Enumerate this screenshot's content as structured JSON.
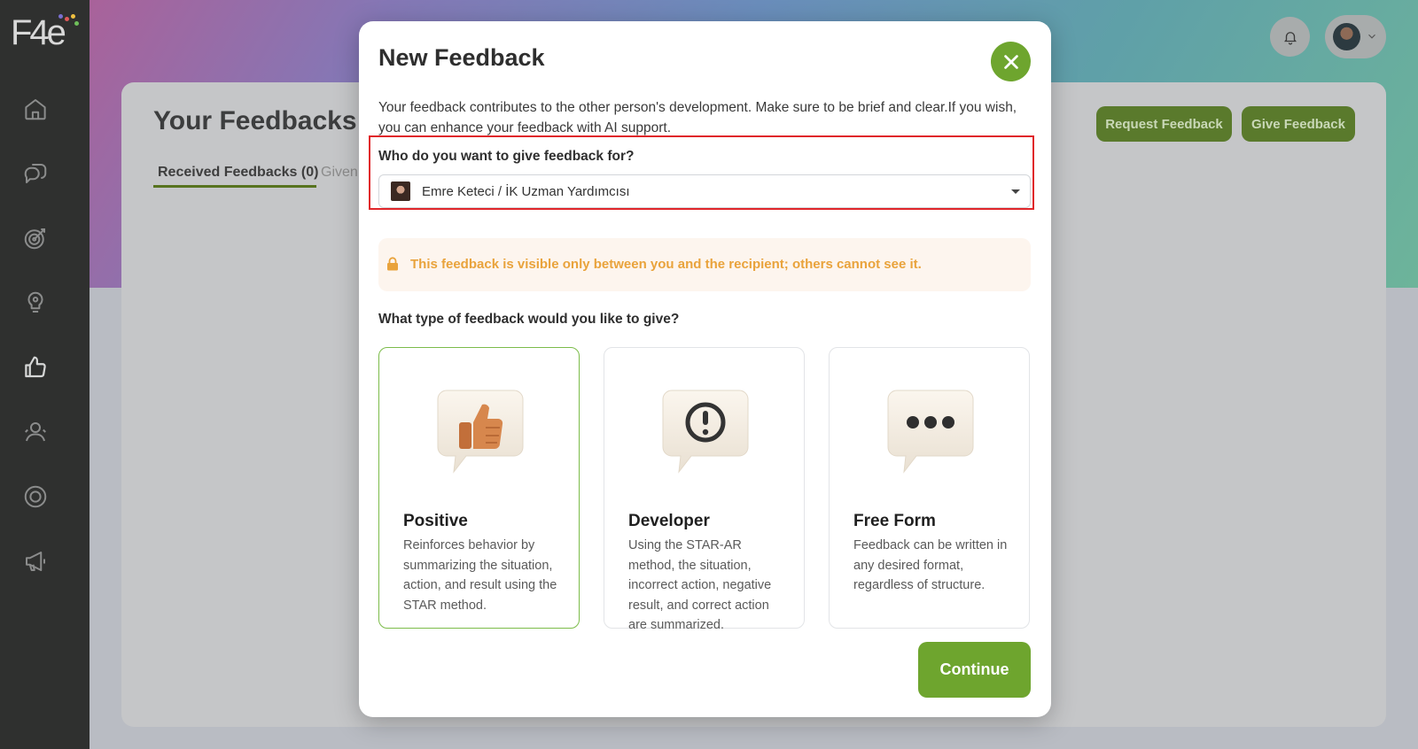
{
  "app": {
    "logo_text": "F4e"
  },
  "sidebar": {
    "items": [
      {
        "icon": "home-icon"
      },
      {
        "icon": "chat-icon"
      },
      {
        "icon": "target-icon"
      },
      {
        "icon": "lightbulb-icon"
      },
      {
        "icon": "thumbs-up-icon",
        "active": true
      },
      {
        "icon": "users-icon"
      },
      {
        "icon": "settings-icon"
      },
      {
        "icon": "megaphone-icon"
      }
    ]
  },
  "header": {
    "bell_icon": "bell-icon"
  },
  "page": {
    "title": "Your Feedbacks",
    "tabs": [
      {
        "label": "Received Feedbacks (0)",
        "active": true
      },
      {
        "label": "Given"
      }
    ],
    "request_button": "Request Feedback",
    "give_button": "Give Feedback"
  },
  "modal": {
    "title": "New Feedback",
    "intro": "Your feedback contributes to the other person's development. Make sure to be brief and clear.If you wish, you can enhance your feedback with AI support.",
    "who_label": "Who do you want to give feedback for?",
    "recipient": "Emre Keteci / İK Uzman Yardımcısı",
    "privacy_notice": "This feedback is visible only between you and the recipient; others cannot see it.",
    "type_label": "What type of feedback would you like to give?",
    "types": [
      {
        "title": "Positive",
        "description": "Reinforces behavior by summarizing the situation, action, and result using the STAR method.",
        "selected": true
      },
      {
        "title": "Developer",
        "description": "Using the STAR-AR method, the situation, incorrect action, negative result, and correct action are summarized."
      },
      {
        "title": "Free Form",
        "description": "Feedback can be written in any desired format, regardless of structure."
      }
    ],
    "continue_label": "Continue"
  },
  "colors": {
    "accent": "#6ea52e",
    "dark_accent": "#5a7a2c",
    "highlight_border": "#e0262a",
    "notice_text": "#e9a33c"
  }
}
